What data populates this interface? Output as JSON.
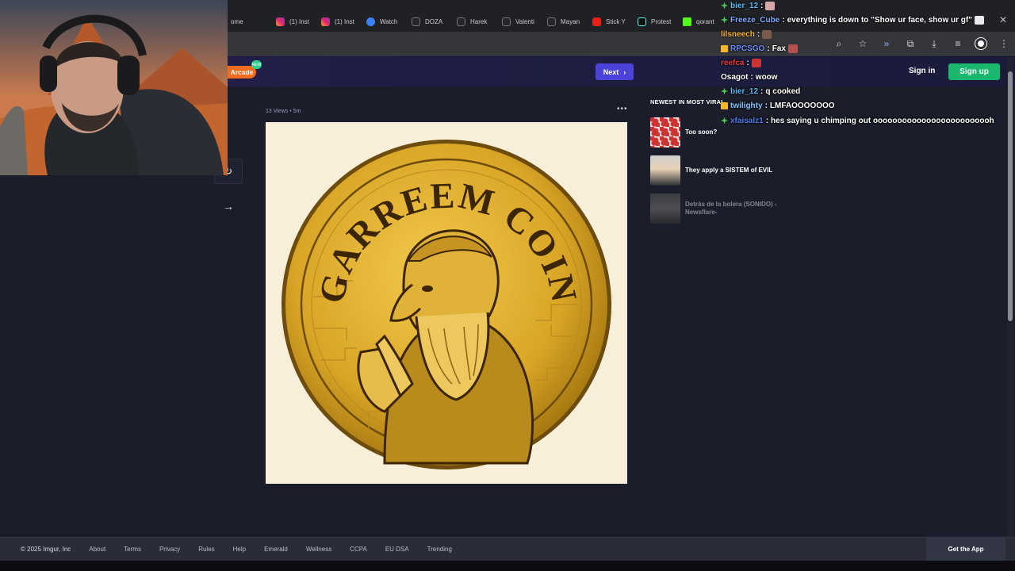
{
  "tabs": [
    {
      "label": "ome",
      "icon": "home-icon"
    },
    {
      "label": "(1) Inst",
      "icon": "instagram-icon"
    },
    {
      "label": "(1) Inst",
      "icon": "instagram-icon"
    },
    {
      "label": "Watch",
      "icon": "watch-icon"
    },
    {
      "label": "DOZA",
      "icon": "x-icon"
    },
    {
      "label": "Harek",
      "icon": "x-icon"
    },
    {
      "label": "Valenti",
      "icon": "x-icon"
    },
    {
      "label": "Mayan",
      "icon": "x-icon"
    },
    {
      "label": "Stick Y",
      "icon": "youtube-icon"
    },
    {
      "label": "Protest",
      "icon": "tiktok-icon"
    },
    {
      "label": "qorant",
      "icon": "kick-icon"
    }
  ],
  "header": {
    "arcade_label": "Arcade",
    "arcade_badge": "NEW",
    "next_label": "Next",
    "sign_in": "Sign in",
    "sign_up": "Sign up"
  },
  "post": {
    "meta": "13 Views • 5m",
    "image_alt": "GARREEM COIN",
    "coin_text": "GARREEM COIN"
  },
  "sidebar": {
    "title": "NEWEST IN MOST VIRAL",
    "items": [
      {
        "label": "Too soon?"
      },
      {
        "label": "They apply a SISTEM of EVIL"
      },
      {
        "label": "Detrás de la bolera (SONIDO) - Newsflare-"
      }
    ]
  },
  "footer": {
    "copyright": "© 2025 Imgur, Inc",
    "links": [
      "About",
      "Terms",
      "Privacy",
      "Rules",
      "Help",
      "Emerald",
      "Wellness",
      "CCPA",
      "EU DSA",
      "Trending"
    ],
    "get_app": "Get the App"
  },
  "chat": [
    {
      "user": "bier_12",
      "color": "#5fb8f2",
      "badge": "green",
      "message": "",
      "emote": "em-1"
    },
    {
      "user": "Freeze_Cube",
      "color": "#7fa9ff",
      "badge": "green",
      "message": "everything is down to \"Show ur face, show ur gf\"",
      "emote": "em-5"
    },
    {
      "user": "lilsneech",
      "color": "#f5b629",
      "badge": "",
      "message": "",
      "emote": "em-2"
    },
    {
      "user": "RPCSGO",
      "color": "#6e8bff",
      "badge": "yellow",
      "message": "Fax",
      "emote": "em-3"
    },
    {
      "user": "reefca",
      "color": "#e23d3d",
      "badge": "",
      "message": "",
      "emote": "em-4"
    },
    {
      "user": "Osagot",
      "color": "#ffffff",
      "badge": "",
      "message": "woow",
      "emote": ""
    },
    {
      "user": "bier_12",
      "color": "#5fb8f2",
      "badge": "green",
      "message": "q cooked",
      "emote": ""
    },
    {
      "user": "twilighty",
      "color": "#83c7ff",
      "badge": "yellow",
      "message": "LMFAOOOOOOO",
      "emote": ""
    },
    {
      "user": "xfaisalz1",
      "color": "#4a7cf0",
      "badge": "green",
      "message": "hes saying u chimping out ooooooooooooooooooooooooh",
      "emote": ""
    }
  ],
  "colors": {
    "accent": "#4b43d9",
    "signup": "#1bb76e",
    "arcade": "#f26c20",
    "coin_gold": "#d9a526"
  }
}
